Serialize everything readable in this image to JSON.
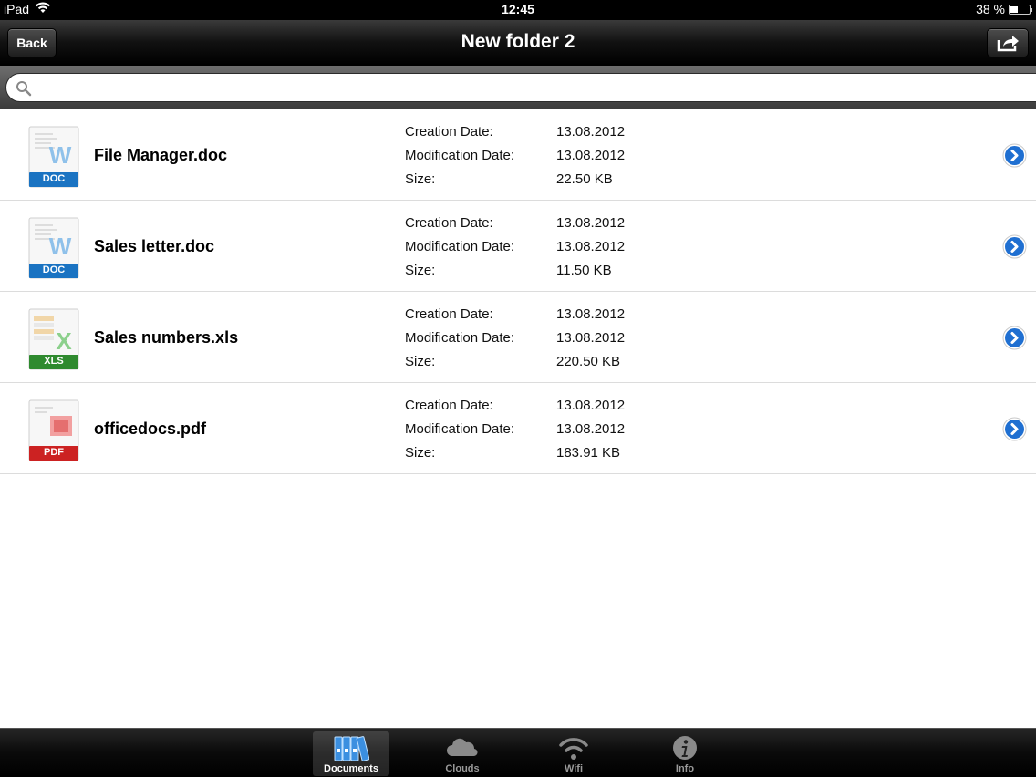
{
  "status_bar": {
    "device": "iPad",
    "time": "12:45",
    "battery": "38 %",
    "battery_level": 0.38
  },
  "nav": {
    "title": "New folder 2",
    "back_label": "Back"
  },
  "search": {
    "placeholder": "",
    "value": ""
  },
  "files": [
    {
      "name": "File Manager.doc",
      "type_badge": "DOC",
      "badge_color": "#1a73c2",
      "creation_label": "Creation Date:",
      "creation_date": "13.08.2012",
      "modification_label": "Modification Date:",
      "modification_date": "13.08.2012",
      "size_label": "Size:",
      "size": "22.50 KB"
    },
    {
      "name": "Sales letter.doc",
      "type_badge": "DOC",
      "badge_color": "#1a73c2",
      "creation_label": "Creation Date:",
      "creation_date": "13.08.2012",
      "modification_label": "Modification Date:",
      "modification_date": "13.08.2012",
      "size_label": "Size:",
      "size": "11.50 KB"
    },
    {
      "name": "Sales numbers.xls",
      "type_badge": "XLS",
      "badge_color": "#2f8a2f",
      "creation_label": "Creation Date:",
      "creation_date": "13.08.2012",
      "modification_label": "Modification Date:",
      "modification_date": "13.08.2012",
      "size_label": "Size:",
      "size": "220.50 KB"
    },
    {
      "name": "officedocs.pdf",
      "type_badge": "PDF",
      "badge_color": "#cc2222",
      "creation_label": "Creation Date:",
      "creation_date": "13.08.2012",
      "modification_label": "Modification Date:",
      "modification_date": "13.08.2012",
      "size_label": "Size:",
      "size": "183.91 KB"
    }
  ],
  "tabs": [
    {
      "label": "Documents",
      "icon": "documents-icon",
      "selected": true
    },
    {
      "label": "Clouds",
      "icon": "cloud-icon",
      "selected": false
    },
    {
      "label": "Wifi",
      "icon": "wifi-icon",
      "selected": false
    },
    {
      "label": "Info",
      "icon": "info-icon",
      "selected": false
    }
  ],
  "colors": {
    "accent_blue": "#1f6fd1",
    "nav_dark": "#111111"
  }
}
